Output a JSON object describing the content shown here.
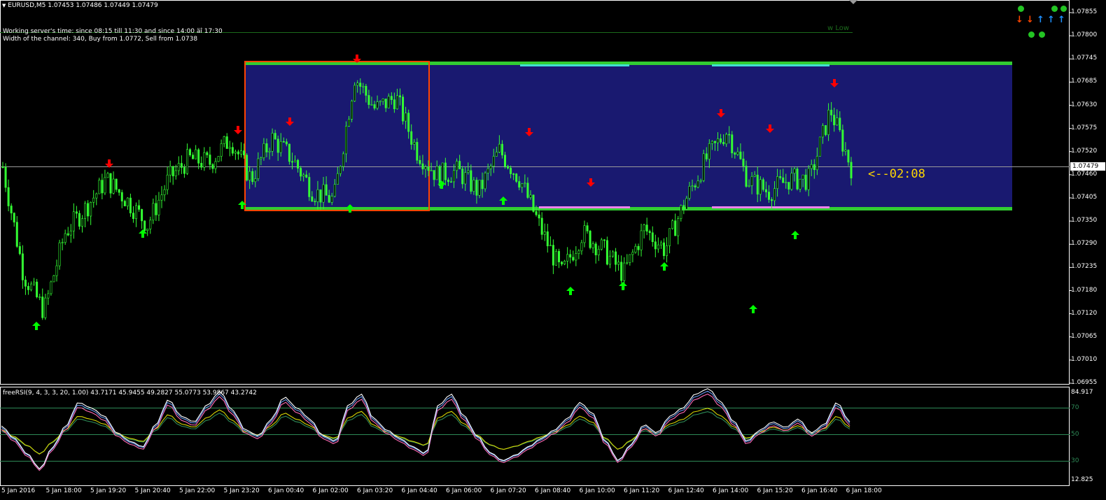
{
  "header": {
    "symbol_line": "EURUSD,M5  1.07453 1.07486 1.07449 1.07479",
    "server_time": "Working server's time: since 08:15 till 11:30 and since 14:00 äî 17:30",
    "channel_info": "Width of the channel: 340, Buy from 1.0772, Sell from 1.0738",
    "w_low": "w Low"
  },
  "price_axis": {
    "labels": [
      "1.07855",
      "1.07800",
      "1.07745",
      "1.07685",
      "1.07630",
      "1.07575",
      "1.07520",
      "1.07460",
      "1.07405",
      "1.07350",
      "1.07290",
      "1.07235",
      "1.07180",
      "1.07120",
      "1.07065",
      "1.07010",
      "1.06955"
    ],
    "current_price": "1.07479"
  },
  "countdown": "<--02:08",
  "indicator": {
    "title": "freeRSI(9, 4, 3, 3, 20, 1.00) 43.7171 45.9455 49.2827 55.0773 53.9867 43.2742",
    "max": "84.917",
    "min": "12.825",
    "levels": [
      "70",
      "50",
      "30"
    ]
  },
  "time_axis": [
    "5 Jan 2016",
    "5 Jan 18:00",
    "5 Jan 19:20",
    "5 Jan 20:40",
    "5 Jan 22:00",
    "5 Jan 23:20",
    "6 Jan 00:40",
    "6 Jan 02:00",
    "6 Jan 03:20",
    "6 Jan 04:40",
    "6 Jan 06:00",
    "6 Jan 07:20",
    "6 Jan 08:40",
    "6 Jan 10:00",
    "6 Jan 11:20",
    "6 Jan 12:40",
    "6 Jan 14:00",
    "6 Jan 15:20",
    "6 Jan 16:40",
    "6 Jan 18:00"
  ],
  "colors": {
    "background": "#000000",
    "candle": "#33ff33",
    "channel_fill": "#191970",
    "channel_border": "#32cd32",
    "session_box": "#ff4500",
    "resistance_tick": "#40e0d0",
    "support_tick": "#ee82ee",
    "arrow_up": "#00ff00",
    "arrow_down": "#ff0000",
    "countdown": "#ffd700",
    "rsi_white": "#ffffff",
    "rsi_blue": "#6495ed",
    "rsi_pink": "#ff69b4",
    "rsi_yellow": "#d4d400",
    "rsi_green": "#2e8b57"
  },
  "widget": {
    "icons": [
      "green-dot",
      "green-dot",
      "green-dot",
      "orange-arrow-down-icon",
      "orange-arrow-down-icon",
      "blue-arrow-up-icon",
      "blue-arrow-up-icon",
      "blue-arrow-up-icon",
      "green-dot",
      "green-dot"
    ]
  },
  "chart_data": {
    "type": "candlestick",
    "symbol": "EURUSD",
    "timeframe": "M5",
    "last_bar": {
      "open": 1.07453,
      "high": 1.07486,
      "low": 1.07449,
      "close": 1.07479
    },
    "ylim": [
      1.06955,
      1.07855
    ],
    "x_range": [
      "5 Jan 2016 16:40",
      "6 Jan 18:00"
    ],
    "channel": {
      "top": 1.0772,
      "bottom": 1.0738,
      "width_points": 340
    },
    "approx_close_path": [
      {
        "t": "5 Jan 16:40",
        "v": 1.0748
      },
      {
        "t": "5 Jan 17:20",
        "v": 1.0722
      },
      {
        "t": "5 Jan 17:40",
        "v": 1.0713
      },
      {
        "t": "5 Jan 18:20",
        "v": 1.0732
      },
      {
        "t": "5 Jan 19:00",
        "v": 1.0738
      },
      {
        "t": "5 Jan 19:40",
        "v": 1.0745
      },
      {
        "t": "5 Jan 20:20",
        "v": 1.074
      },
      {
        "t": "5 Jan 20:40",
        "v": 1.0734
      },
      {
        "t": "5 Jan 21:40",
        "v": 1.0745
      },
      {
        "t": "5 Jan 22:20",
        "v": 1.075
      },
      {
        "t": "5 Jan 23:00",
        "v": 1.0749
      },
      {
        "t": "5 Jan 23:40",
        "v": 1.0755
      },
      {
        "t": "6 Jan 00:00",
        "v": 1.0745
      },
      {
        "t": "6 Jan 00:40",
        "v": 1.0755
      },
      {
        "t": "6 Jan 01:20",
        "v": 1.075
      },
      {
        "t": "6 Jan 02:00",
        "v": 1.0742
      },
      {
        "t": "6 Jan 02:40",
        "v": 1.074
      },
      {
        "t": "6 Jan 03:00",
        "v": 1.077
      },
      {
        "t": "6 Jan 03:40",
        "v": 1.0762
      },
      {
        "t": "6 Jan 04:20",
        "v": 1.0765
      },
      {
        "t": "6 Jan 04:40",
        "v": 1.0752
      },
      {
        "t": "6 Jan 05:20",
        "v": 1.0746
      },
      {
        "t": "6 Jan 06:00",
        "v": 1.0747
      },
      {
        "t": "6 Jan 06:40",
        "v": 1.0742
      },
      {
        "t": "6 Jan 07:20",
        "v": 1.0752
      },
      {
        "t": "6 Jan 07:40",
        "v": 1.0745
      },
      {
        "t": "6 Jan 08:20",
        "v": 1.0733
      },
      {
        "t": "6 Jan 08:40",
        "v": 1.0722
      },
      {
        "t": "6 Jan 09:20",
        "v": 1.0732
      },
      {
        "t": "6 Jan 10:00",
        "v": 1.0728
      },
      {
        "t": "6 Jan 10:40",
        "v": 1.0722
      },
      {
        "t": "6 Jan 11:20",
        "v": 1.0733
      },
      {
        "t": "6 Jan 12:00",
        "v": 1.0728
      },
      {
        "t": "6 Jan 12:40",
        "v": 1.074
      },
      {
        "t": "6 Jan 13:20",
        "v": 1.075
      },
      {
        "t": "6 Jan 14:00",
        "v": 1.0757
      },
      {
        "t": "6 Jan 14:40",
        "v": 1.0745
      },
      {
        "t": "6 Jan 15:20",
        "v": 1.0742
      },
      {
        "t": "6 Jan 16:00",
        "v": 1.0745
      },
      {
        "t": "6 Jan 16:40",
        "v": 1.0745
      },
      {
        "t": "6 Jan 17:20",
        "v": 1.0762
      },
      {
        "t": "6 Jan 17:40",
        "v": 1.0748
      }
    ],
    "rsi": {
      "ylim": [
        12.825,
        84.917
      ],
      "levels": [
        70,
        50,
        30
      ],
      "last_values": [
        43.7171,
        45.9455,
        49.2827,
        55.0773,
        53.9867,
        43.2742
      ]
    }
  }
}
